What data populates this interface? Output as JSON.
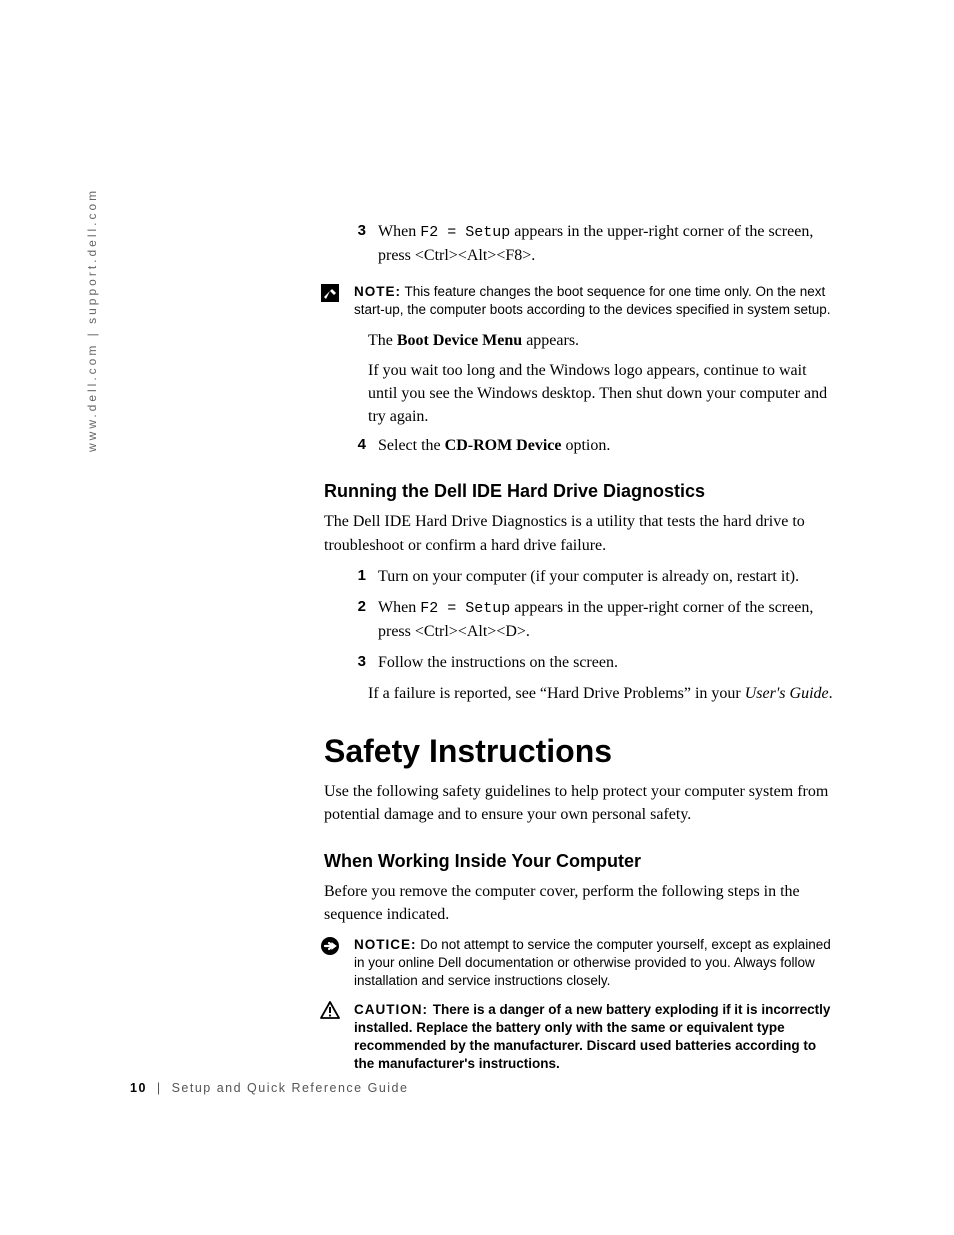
{
  "sidebar": {
    "text": "www.dell.com | support.dell.com"
  },
  "step3": {
    "num": "3",
    "pre": "When ",
    "mono": "F2 = Setup",
    "post": " appears in the upper-right corner of the screen, press <Ctrl><Alt><F8>."
  },
  "note1": {
    "label": "NOTE:",
    "text": " This feature changes the boot sequence for one time only. On the next start-up, the computer boots according to the devices specified in system setup."
  },
  "step3b": {
    "line1_pre": "The ",
    "line1_bold": "Boot Device Menu",
    "line1_post": " appears.",
    "line2": "If you wait too long and the Windows logo appears, continue to wait until you see the Windows desktop. Then shut down your computer and try again."
  },
  "step4": {
    "num": "4",
    "pre": "Select the ",
    "bold": "CD-ROM Device",
    "post": " option."
  },
  "sectionA": {
    "heading": "Running the Dell IDE Hard Drive Diagnostics",
    "intro": "The Dell IDE Hard Drive Diagnostics is a utility that tests the hard drive to troubleshoot or confirm a hard drive failure."
  },
  "listA": {
    "i1": {
      "num": "1",
      "text": "Turn on your computer (if your computer is already on, restart it)."
    },
    "i2": {
      "num": "2",
      "pre": "When ",
      "mono": "F2 = Setup",
      "post": " appears in the upper-right corner of the screen, press <Ctrl><Alt><D>."
    },
    "i3": {
      "num": "3",
      "text": "Follow the instructions on the screen."
    },
    "tail_pre": "If a failure is reported, see “Hard Drive Problems” in your ",
    "tail_ital": "User's Guide",
    "tail_post": "."
  },
  "sectionB": {
    "heading": "Safety Instructions",
    "intro": "Use the following safety guidelines to help protect your computer system from potential damage and to ensure your own personal safety."
  },
  "sectionC": {
    "heading": "When Working Inside Your Computer",
    "intro": "Before you remove the computer cover, perform the following steps in the sequence indicated."
  },
  "notice1": {
    "label": "NOTICE:",
    "text": " Do not attempt to service the computer yourself, except as explained in your online Dell documentation or otherwise provided to you. Always follow installation and service instructions closely."
  },
  "caution1": {
    "label": "CAUTION: ",
    "text": "There is a danger of a new battery exploding if it is incorrectly installed. Replace the battery only with the same or equivalent type recommended by the manufacturer. Discard used batteries according to the manufacturer's instructions."
  },
  "footer": {
    "pageno": "10",
    "title": "Setup and Quick Reference Guide"
  }
}
